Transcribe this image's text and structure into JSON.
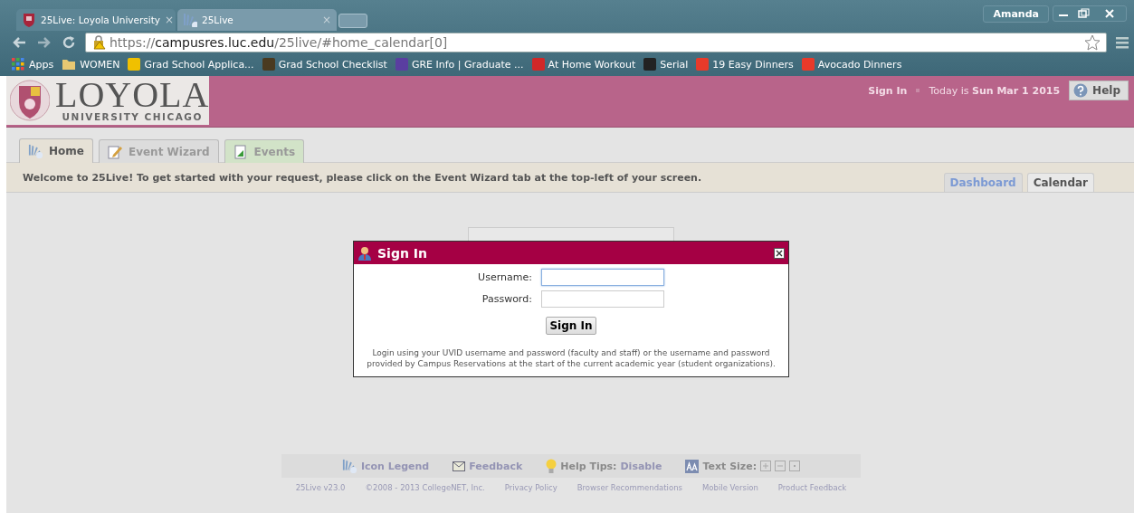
{
  "browser": {
    "tabs": [
      {
        "title": "25Live: Loyola University",
        "close": "×",
        "selected": false
      },
      {
        "title": "25Live",
        "close": "×",
        "selected": true
      }
    ],
    "profile": "Amanda",
    "address": {
      "scheme": "https://",
      "host": "campusres.luc.edu",
      "path": "/25live/#home_calendar[0]"
    },
    "bookmarks": [
      {
        "label": "Apps",
        "kind": "apps"
      },
      {
        "label": "WOMEN",
        "kind": "folder"
      },
      {
        "label": "Grad School Applica...",
        "kind": "site"
      },
      {
        "label": "Grad School Checklist",
        "kind": "site"
      },
      {
        "label": "GRE Info | Graduate ...",
        "kind": "site"
      },
      {
        "label": "At Home Workout",
        "kind": "site"
      },
      {
        "label": "Serial",
        "kind": "site"
      },
      {
        "label": "19 Easy Dinners",
        "kind": "site"
      },
      {
        "label": "Avocado Dinners",
        "kind": "site"
      }
    ]
  },
  "header": {
    "logo_name": "LOYOLA",
    "logo_subtitle": "UNIVERSITY CHICAGO",
    "sign_in": "Sign In",
    "today_prefix": "Today is",
    "today_date": "Sun Mar 1 2015",
    "help": "Help"
  },
  "app_tabs": [
    {
      "label": "Home",
      "selected": true
    },
    {
      "label": "Event Wizard",
      "selected": false
    },
    {
      "label": "Events",
      "selected": false
    }
  ],
  "welcome": "Welcome to 25Live! To get started with your request, please click on the Event Wizard tab at the top-left of your screen.",
  "view_tabs": [
    {
      "label": "Dashboard",
      "selected": false
    },
    {
      "label": "Calendar",
      "selected": true
    }
  ],
  "dialog": {
    "title": "Sign In",
    "fields": [
      {
        "label": "Username:",
        "focused": true
      },
      {
        "label": "Password:",
        "focused": false
      }
    ],
    "button": "Sign In",
    "note": "Login using your UVID username and password (faculty and staff) or the username and password provided by Campus Reservations at the start of the current academic year (student organizations)."
  },
  "footer": {
    "icon_legend": "Icon Legend",
    "feedback": "Feedback",
    "help_tips": "Help Tips:",
    "help_tips_action": "Disable",
    "text_size": "Text Size:",
    "links": [
      "25Live v23.0",
      "©2008 - 2013 CollegeNET, Inc.",
      "Privacy Policy",
      "Browser Recommendations",
      "Mobile Version",
      "Product Feedback"
    ]
  }
}
